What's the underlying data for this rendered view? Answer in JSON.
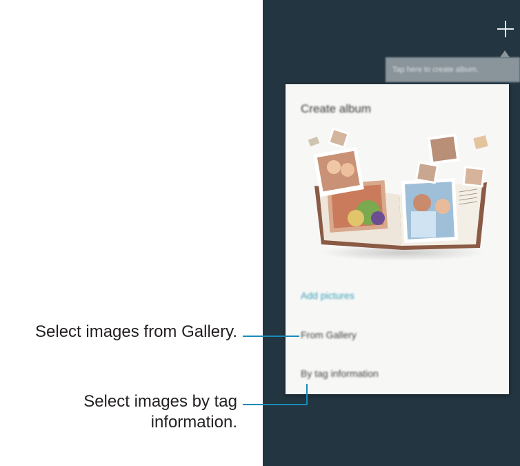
{
  "screen": {
    "tooltip_text": "Tap here to create album.",
    "add_icon": "plus-icon"
  },
  "dialog": {
    "title": "Create album",
    "section_label": "Add pictures",
    "items": [
      {
        "label": "From Gallery"
      },
      {
        "label": "By tag information"
      }
    ]
  },
  "callouts": {
    "gallery": "Select images from Gallery.",
    "tag_line1": "Select images by tag",
    "tag_line2": "information."
  },
  "colors": {
    "screen_bg": "#233540",
    "accent": "#3aa1ba",
    "callout_line": "#1a8ab8"
  }
}
